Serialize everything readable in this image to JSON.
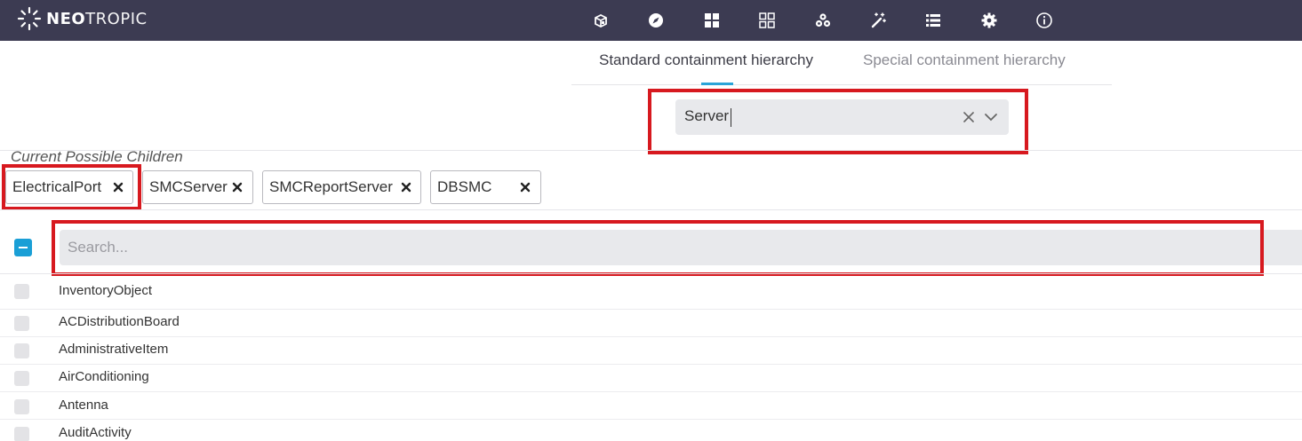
{
  "brand": {
    "name_bold": "NEO",
    "name_light": "TROPIC"
  },
  "nav": {
    "icons": [
      "inventory-icon",
      "navigation-compass-icon",
      "dashboard-grid-icon",
      "modules-grid-icon",
      "data-model-icon",
      "wizard-wand-icon",
      "list-manager-icon",
      "settings-gear-icon",
      "about-info-icon"
    ]
  },
  "tabs": [
    {
      "label": "Standard containment hierarchy",
      "active": true
    },
    {
      "label": "Special containment hierarchy",
      "active": false
    }
  ],
  "class_select": {
    "value": "Server"
  },
  "section": {
    "title": "Current Possible Children"
  },
  "chips": [
    {
      "label": "ElectricalPort"
    },
    {
      "label": "SMCServer"
    },
    {
      "label": "SMCReportServer"
    },
    {
      "label": "DBSMC"
    }
  ],
  "search": {
    "placeholder": "Search...",
    "value": ""
  },
  "list": {
    "items": [
      {
        "label": "InventoryObject"
      },
      {
        "label": "ACDistributionBoard"
      },
      {
        "label": "AdministrativeItem"
      },
      {
        "label": "AirConditioning"
      },
      {
        "label": "Antenna"
      },
      {
        "label": "AuditActivity"
      }
    ]
  },
  "colors": {
    "topbar": "#3c3b52",
    "accent": "#2aa4d8",
    "highlight": "#d7191f"
  }
}
